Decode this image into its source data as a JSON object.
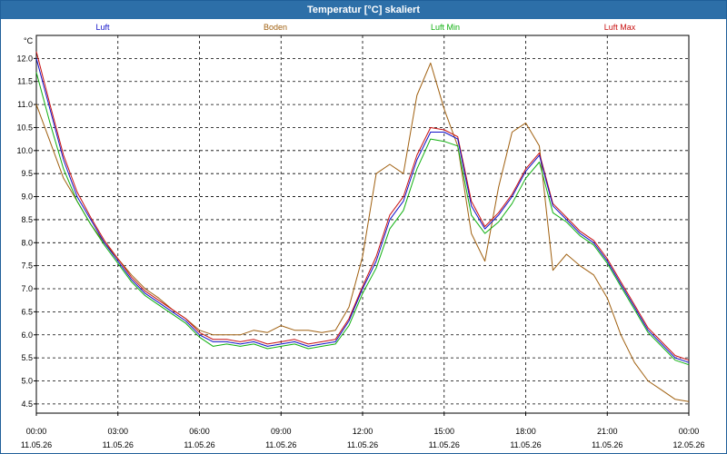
{
  "window": {
    "title": "Temperatur [°C] skaliert"
  },
  "chart_data": {
    "type": "line",
    "title": "Temperatur [°C] skaliert",
    "ylabel": "°C",
    "xlabel": "",
    "ylim": [
      4.3,
      12.5
    ],
    "xlim": [
      0,
      24
    ],
    "yticks": [
      "4.5",
      "5.0",
      "5.5",
      "6.0",
      "6.5",
      "7.0",
      "7.5",
      "8.0",
      "8.5",
      "9.0",
      "9.5",
      "10.0",
      "10.5",
      "11.0",
      "11.5",
      "12.0"
    ],
    "xticks": [
      {
        "time": "00:00",
        "date": "11.05.26"
      },
      {
        "time": "03:00",
        "date": "11.05.26"
      },
      {
        "time": "06:00",
        "date": "11.05.26"
      },
      {
        "time": "09:00",
        "date": "11.05.26"
      },
      {
        "time": "12:00",
        "date": "11.05.26"
      },
      {
        "time": "15:00",
        "date": "11.05.26"
      },
      {
        "time": "18:00",
        "date": "11.05.26"
      },
      {
        "time": "21:00",
        "date": "11.05.26"
      },
      {
        "time": "00:00",
        "date": "12.05.26"
      }
    ],
    "grid": true,
    "legend_position": "top",
    "series": [
      {
        "name": "Luft",
        "color": "#1010c8",
        "x": [
          0,
          0.5,
          1,
          1.5,
          2,
          2.5,
          3,
          3.5,
          4,
          4.5,
          5,
          5.5,
          6,
          6.5,
          7,
          7.5,
          8,
          8.5,
          9,
          9.5,
          10,
          10.5,
          11,
          11.5,
          12,
          12.5,
          13,
          13.5,
          14,
          14.5,
          15,
          15.5,
          16,
          16.5,
          17,
          17.5,
          18,
          18.5,
          19,
          19.5,
          20,
          20.5,
          21,
          21.5,
          22,
          22.5,
          23,
          23.5,
          24
        ],
        "y": [
          12.0,
          10.9,
          9.8,
          9.0,
          8.5,
          8.0,
          7.6,
          7.2,
          6.9,
          6.7,
          6.5,
          6.3,
          6.0,
          5.85,
          5.85,
          5.8,
          5.85,
          5.75,
          5.8,
          5.85,
          5.75,
          5.8,
          5.85,
          6.3,
          7.0,
          7.6,
          8.5,
          8.9,
          9.8,
          10.4,
          10.4,
          10.25,
          8.8,
          8.3,
          8.6,
          9.0,
          9.55,
          9.9,
          8.8,
          8.5,
          8.2,
          8.0,
          7.6,
          7.1,
          6.6,
          6.1,
          5.8,
          5.5,
          5.4
        ]
      },
      {
        "name": "Boden",
        "color": "#a06010",
        "x": [
          0,
          0.5,
          1,
          1.5,
          2,
          2.5,
          3,
          3.5,
          4,
          4.5,
          5,
          5.5,
          6,
          6.5,
          7,
          7.5,
          8,
          8.5,
          9,
          9.5,
          10,
          10.5,
          11,
          11.5,
          12,
          12.5,
          13,
          13.5,
          14,
          14.5,
          15,
          15.5,
          16,
          16.5,
          17,
          17.5,
          18,
          18.5,
          19,
          19.5,
          20,
          20.5,
          21,
          21.5,
          22,
          22.5,
          23,
          23.5,
          24
        ],
        "y": [
          11.0,
          10.2,
          9.4,
          8.9,
          8.4,
          8.0,
          7.65,
          7.3,
          7.0,
          6.8,
          6.55,
          6.35,
          6.1,
          6.0,
          6.0,
          6.0,
          6.1,
          6.05,
          6.2,
          6.1,
          6.1,
          6.05,
          6.1,
          6.6,
          7.7,
          9.5,
          9.7,
          9.5,
          11.2,
          11.9,
          10.9,
          10.1,
          8.2,
          7.6,
          9.2,
          10.4,
          10.6,
          10.1,
          7.4,
          7.75,
          7.5,
          7.3,
          6.8,
          6.0,
          5.4,
          5.0,
          4.8,
          4.6,
          4.55
        ]
      },
      {
        "name": "Luft Min",
        "color": "#10b010",
        "x": [
          0,
          0.5,
          1,
          1.5,
          2,
          2.5,
          3,
          3.5,
          4,
          4.5,
          5,
          5.5,
          6,
          6.5,
          7,
          7.5,
          8,
          8.5,
          9,
          9.5,
          10,
          10.5,
          11,
          11.5,
          12,
          12.5,
          13,
          13.5,
          14,
          14.5,
          15,
          15.5,
          16,
          16.5,
          17,
          17.5,
          18,
          18.5,
          19,
          19.5,
          20,
          20.5,
          21,
          21.5,
          22,
          22.5,
          23,
          23.5,
          24
        ],
        "y": [
          11.7,
          10.6,
          9.6,
          8.9,
          8.4,
          7.95,
          7.55,
          7.15,
          6.85,
          6.65,
          6.45,
          6.25,
          5.95,
          5.75,
          5.8,
          5.75,
          5.8,
          5.7,
          5.75,
          5.8,
          5.7,
          5.75,
          5.8,
          6.2,
          6.9,
          7.45,
          8.3,
          8.7,
          9.6,
          10.25,
          10.2,
          10.1,
          8.6,
          8.2,
          8.45,
          8.85,
          9.4,
          9.75,
          8.65,
          8.45,
          8.15,
          7.95,
          7.55,
          7.05,
          6.55,
          6.05,
          5.75,
          5.45,
          5.35
        ]
      },
      {
        "name": "Luft Max",
        "color": "#c81010",
        "x": [
          0,
          0.5,
          1,
          1.5,
          2,
          2.5,
          3,
          3.5,
          4,
          4.5,
          5,
          5.5,
          6,
          6.5,
          7,
          7.5,
          8,
          8.5,
          9,
          9.5,
          10,
          10.5,
          11,
          11.5,
          12,
          12.5,
          13,
          13.5,
          14,
          14.5,
          15,
          15.5,
          16,
          16.5,
          17,
          17.5,
          18,
          18.5,
          19,
          19.5,
          20,
          20.5,
          21,
          21.5,
          22,
          22.5,
          23,
          23.5,
          24
        ],
        "y": [
          12.15,
          11.0,
          9.9,
          9.1,
          8.55,
          8.05,
          7.65,
          7.25,
          6.95,
          6.75,
          6.55,
          6.35,
          6.05,
          5.9,
          5.9,
          5.85,
          5.9,
          5.8,
          5.85,
          5.9,
          5.8,
          5.85,
          5.9,
          6.35,
          7.05,
          7.7,
          8.6,
          9.0,
          9.9,
          10.5,
          10.45,
          10.3,
          8.9,
          8.35,
          8.65,
          9.05,
          9.6,
          9.95,
          8.85,
          8.55,
          8.25,
          8.05,
          7.65,
          7.15,
          6.65,
          6.15,
          5.85,
          5.55,
          5.45
        ]
      }
    ]
  }
}
